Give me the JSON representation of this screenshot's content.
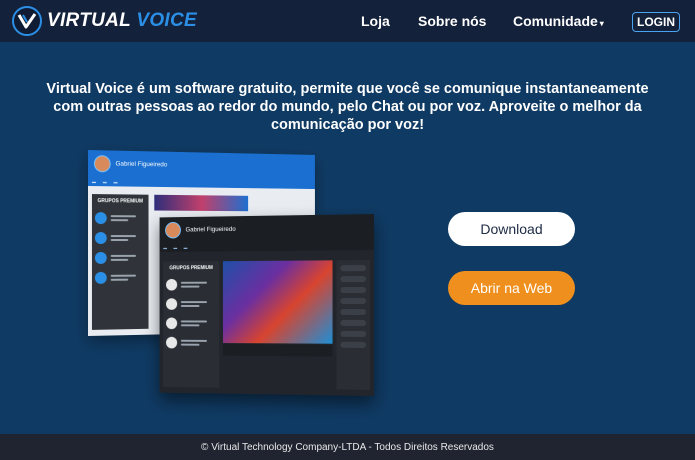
{
  "brand": {
    "name_part1": "VIRTUAL",
    "name_part2": "VOICE",
    "logo_icon": "v-check-logo-icon",
    "accent_color": "#2b8fe6"
  },
  "nav": {
    "loja": "Loja",
    "sobre": "Sobre nós",
    "comunidade": "Comunidade",
    "comunidade_caret": "▾",
    "login": "LOGIN"
  },
  "hero": {
    "text": "Virtual Voice é um software gratuito, permite que você se comunique instantaneamente com outras pessoas ao redor do mundo, pelo Chat ou por voz. Aproveite o melhor da comunicação por voz!"
  },
  "actions": {
    "download_label": "Download",
    "web_label": "Abrir na Web",
    "web_color": "#ef8f1d"
  },
  "mockup": {
    "user_name": "Gabriel Figueiredo",
    "panel_title": "GRUPOS PREMIUM"
  },
  "footer": {
    "text": "© Virtual Technology Company-LTDA - Todos Direitos Reservados"
  }
}
